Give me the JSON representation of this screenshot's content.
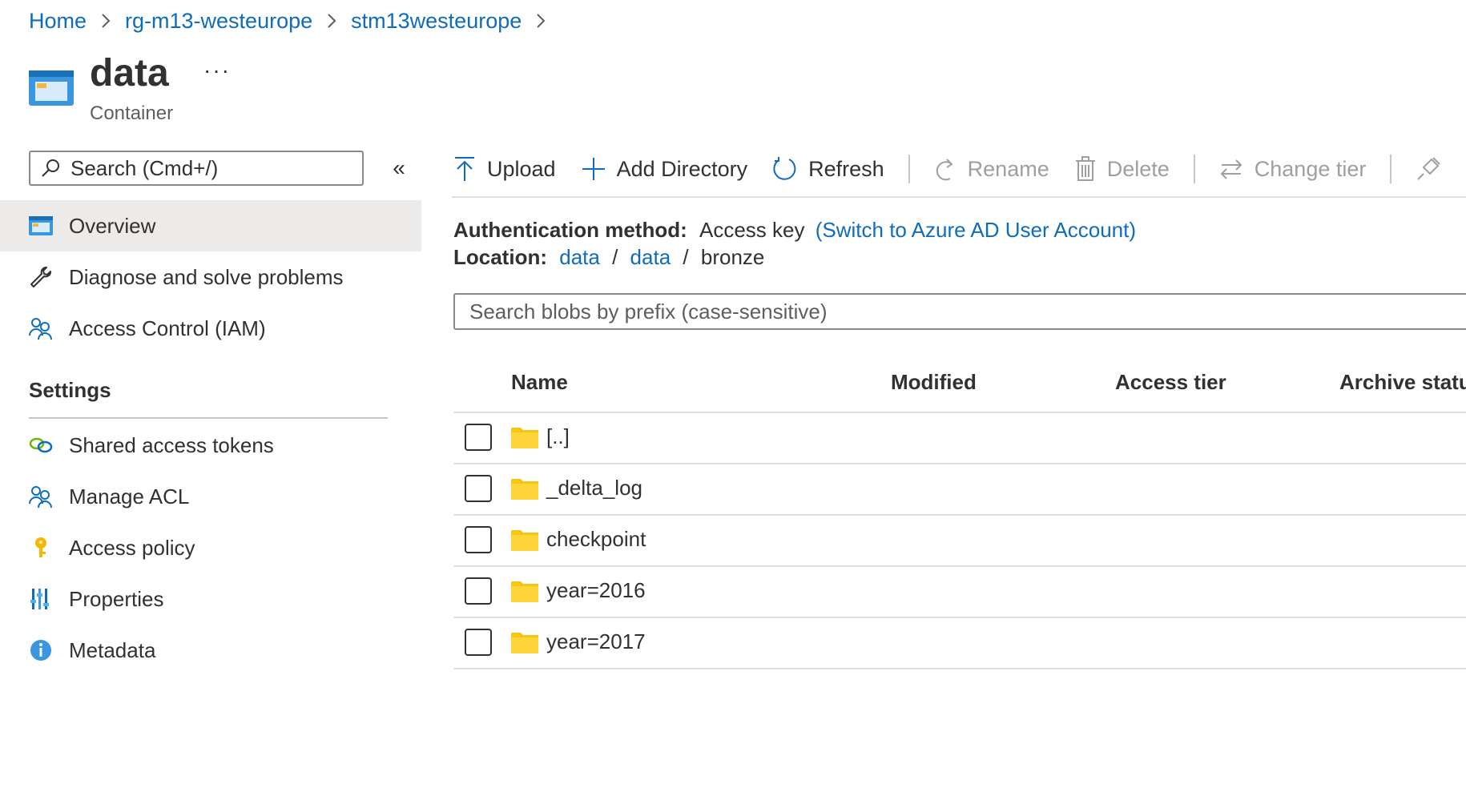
{
  "breadcrumb": [
    "Home",
    "rg-m13-westeurope",
    "stm13westeurope"
  ],
  "header": {
    "title": "data",
    "subtitle": "Container",
    "more": "···"
  },
  "sidebar": {
    "search_placeholder": "Search (Cmd+/)",
    "collapse": "«",
    "items": [
      {
        "label": "Overview",
        "icon": "container-icon",
        "active": true
      },
      {
        "label": "Diagnose and solve problems",
        "icon": "wrench-icon"
      },
      {
        "label": "Access Control (IAM)",
        "icon": "people-icon"
      }
    ],
    "settings_heading": "Settings",
    "settings_items": [
      {
        "label": "Shared access tokens",
        "icon": "link-icon"
      },
      {
        "label": "Manage ACL",
        "icon": "people-icon"
      },
      {
        "label": "Access policy",
        "icon": "key-icon"
      },
      {
        "label": "Properties",
        "icon": "properties-icon"
      },
      {
        "label": "Metadata",
        "icon": "info-icon"
      }
    ]
  },
  "toolbar": {
    "upload": "Upload",
    "add_directory": "Add Directory",
    "refresh": "Refresh",
    "rename": "Rename",
    "delete": "Delete",
    "change_tier": "Change tier"
  },
  "info": {
    "auth_label": "Authentication method:",
    "auth_value": "Access key",
    "auth_switch": "(Switch to Azure AD User Account)",
    "location_label": "Location:",
    "location_path": [
      "data",
      "data",
      "bronze"
    ],
    "path_sep": "/"
  },
  "blob_search": {
    "placeholder": "Search blobs by prefix (case-sensitive)"
  },
  "table": {
    "columns": [
      "Name",
      "Modified",
      "Access tier",
      "Archive status"
    ],
    "rows": [
      "[..]",
      "_delta_log",
      "checkpoint",
      "year=2016",
      "year=2017"
    ]
  },
  "colors": {
    "accent": "#0f6cbd",
    "folder": "#f5c518",
    "active_bg": "#edebe9"
  }
}
